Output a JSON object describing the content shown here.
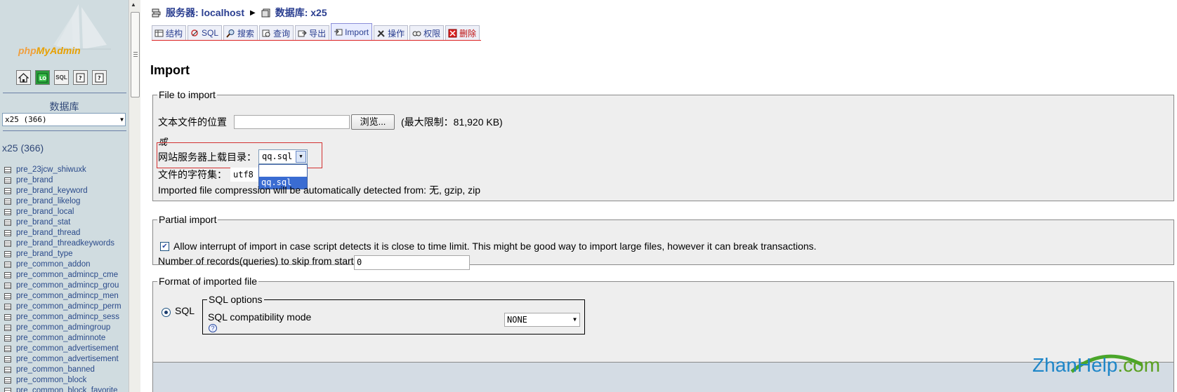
{
  "sidebar": {
    "logo_text_php": "php",
    "logo_text_my": "MyAdmin",
    "icon_buttons": [
      "home-icon",
      "query-window-icon",
      "sql-icon",
      "docs-icon",
      "changelog-icon"
    ],
    "icon_labels": [
      "",
      "",
      "SQL",
      "",
      ""
    ],
    "db_label": "数据库",
    "db_select_value": "x25 (366)",
    "db_name": "x25 (366)",
    "tables": [
      "pre_23jcw_shiwuxk",
      "pre_brand",
      "pre_brand_keyword",
      "pre_brand_likelog",
      "pre_brand_local",
      "pre_brand_stat",
      "pre_brand_thread",
      "pre_brand_threadkeywords",
      "pre_brand_type",
      "pre_common_addon",
      "pre_common_admincp_cme",
      "pre_common_admincp_grou",
      "pre_common_admincp_men",
      "pre_common_admincp_perm",
      "pre_common_admincp_sess",
      "pre_common_admingroup",
      "pre_common_adminnote",
      "pre_common_advertisement",
      "pre_common_advertisement",
      "pre_common_banned",
      "pre_common_block",
      "pre_common_block_favorite"
    ]
  },
  "breadcrumb": {
    "server": "服务器: localhost",
    "database": "数据库: x25"
  },
  "tabs": [
    {
      "label": "结构",
      "icon": "structure-icon"
    },
    {
      "label": "SQL",
      "icon": "sql-icon"
    },
    {
      "label": "搜索",
      "icon": "search-icon"
    },
    {
      "label": "查询",
      "icon": "query-icon"
    },
    {
      "label": "导出",
      "icon": "export-icon"
    },
    {
      "label": "Import",
      "icon": "import-icon"
    },
    {
      "label": "操作",
      "icon": "operations-icon"
    },
    {
      "label": "权限",
      "icon": "privileges-icon"
    },
    {
      "label": "删除",
      "icon": "drop-icon"
    }
  ],
  "page_title": "Import",
  "file_to_import": {
    "legend": "File to import",
    "location_label": "文本文件的位置",
    "location_value": "",
    "browse_button": "浏览...",
    "max_limit": "(最大限制：81,920 KB)",
    "or_label": "或",
    "server_dir_label": "网站服务器上载目录：",
    "server_dir_value": "qq.sql",
    "dropdown_options": [
      "",
      "qq.sql"
    ],
    "charset_label": "文件的字符集：",
    "charset_value": "utf8",
    "compression_note": "Imported file compression will be automatically detected from: 无, gzip, zip"
  },
  "partial_import": {
    "legend": "Partial import",
    "allow_interrupt_label": "Allow interrupt of import in case script detects it is close to time limit. This might be good way to import large files, however it can break transactions.",
    "allow_interrupt_checked": true,
    "skip_label": "Number of records(queries) to skip from start",
    "skip_value": "0"
  },
  "format": {
    "legend": "Format of imported file",
    "sql_label": "SQL",
    "sql_selected": true,
    "sql_options_legend": "SQL options",
    "compat_label": "SQL compatibility mode",
    "compat_value": "NONE"
  },
  "watermark": {
    "text_main": "ZhanHelp",
    "text_dot": ".com",
    "arc_color": "#4aa62a"
  }
}
